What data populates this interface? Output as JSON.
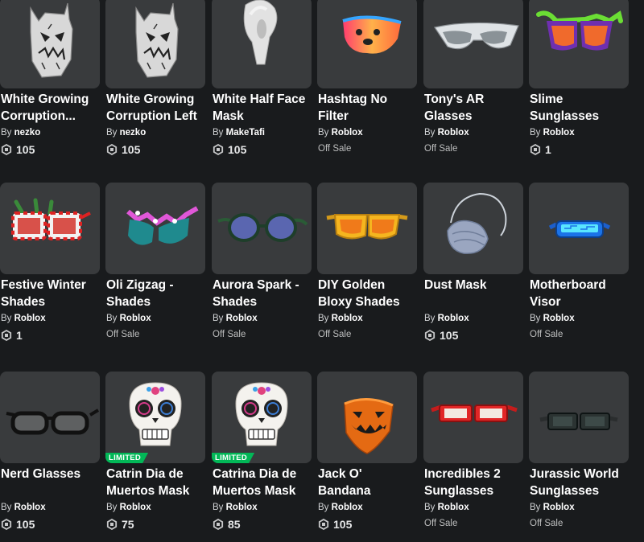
{
  "items": [
    {
      "name": "White Growing Corruption...",
      "by": "By",
      "creator": "nezko",
      "price": "105",
      "offsale": false,
      "limited": false,
      "icon": "white-growing-corruption-mask"
    },
    {
      "name": "White Growing Corruption Left",
      "by": "By",
      "creator": "nezko",
      "price": "105",
      "offsale": false,
      "limited": false,
      "icon": "white-growing-corruption-left-mask"
    },
    {
      "name": "White Half Face Mask",
      "by": "By",
      "creator": "MakeTafi",
      "price": "105",
      "offsale": false,
      "limited": false,
      "icon": "white-half-face-mask"
    },
    {
      "name": "Hashtag No Filter",
      "by": "By",
      "creator": "Roblox",
      "price": "Off Sale",
      "offsale": true,
      "limited": false,
      "icon": "bear-face-visor"
    },
    {
      "name": "Tony's AR Glasses",
      "by": "By",
      "creator": "Roblox",
      "price": "Off Sale",
      "offsale": true,
      "limited": false,
      "icon": "ar-glasses"
    },
    {
      "name": "Slime Sunglasses",
      "by": "By",
      "creator": "Roblox",
      "price": "1",
      "offsale": false,
      "limited": false,
      "icon": "slime-sunglasses"
    },
    {
      "name": "Festive Winter Shades",
      "by": "By",
      "creator": "Roblox",
      "price": "1",
      "offsale": false,
      "limited": false,
      "icon": "festive-shades"
    },
    {
      "name": "Oli Zigzag - Shades",
      "by": "By",
      "creator": "Roblox",
      "price": "Off Sale",
      "offsale": true,
      "limited": false,
      "icon": "zigzag-shades"
    },
    {
      "name": "Aurora Spark - Shades",
      "by": "By",
      "creator": "Roblox",
      "price": "Off Sale",
      "offsale": true,
      "limited": false,
      "icon": "round-shades"
    },
    {
      "name": "DIY Golden Bloxy Shades",
      "by": "By",
      "creator": "Roblox",
      "price": "Off Sale",
      "offsale": true,
      "limited": false,
      "icon": "golden-shades"
    },
    {
      "name": "Dust Mask",
      "by": "By",
      "creator": "Roblox",
      "price": "105",
      "offsale": false,
      "limited": false,
      "icon": "dust-mask"
    },
    {
      "name": "Motherboard Visor",
      "by": "By",
      "creator": "Roblox",
      "price": "Off Sale",
      "offsale": true,
      "limited": false,
      "icon": "motherboard-visor"
    },
    {
      "name": "Nerd Glasses",
      "by": "By",
      "creator": "Roblox",
      "price": "105",
      "offsale": false,
      "limited": false,
      "icon": "nerd-glasses"
    },
    {
      "name": "Catrin Dia de Muertos Mask",
      "by": "By",
      "creator": "Roblox",
      "price": "75",
      "offsale": false,
      "limited": true,
      "limited_label": "LIMITED",
      "icon": "sugar-skull-mask"
    },
    {
      "name": "Catrina Dia de Muertos Mask",
      "by": "By",
      "creator": "Roblox",
      "price": "85",
      "offsale": false,
      "limited": true,
      "limited_label": "LIMITED",
      "icon": "sugar-skull-mask"
    },
    {
      "name": "Jack O' Bandana",
      "by": "By",
      "creator": "Roblox",
      "price": "105",
      "offsale": false,
      "limited": false,
      "icon": "pumpkin-bandana"
    },
    {
      "name": "Incredibles 2 Sunglasses",
      "by": "By",
      "creator": "Roblox",
      "price": "Off Sale",
      "offsale": true,
      "limited": false,
      "icon": "incredibles-sunglasses"
    },
    {
      "name": "Jurassic World Sunglasses",
      "by": "By",
      "creator": "Roblox",
      "price": "Off Sale",
      "offsale": true,
      "limited": false,
      "icon": "jurassic-sunglasses"
    }
  ],
  "colors": {
    "background": "#191b1d",
    "card": "#393b3d",
    "limited_badge": "#02b757"
  }
}
